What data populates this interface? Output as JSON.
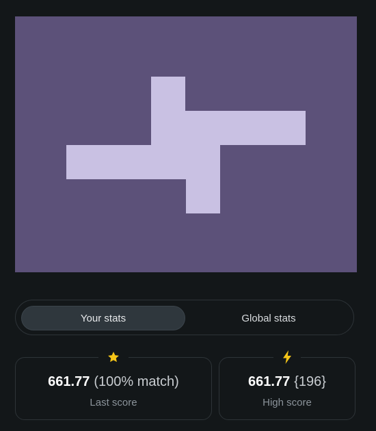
{
  "puzzle": {
    "background_color": "#5c5179",
    "piece_color": "#c9c1e3"
  },
  "tabs": {
    "your_stats": "Your stats",
    "global_stats": "Global stats",
    "active": "your_stats"
  },
  "last_score": {
    "icon": "star-icon",
    "icon_color": "#f5c518",
    "value": "661.77",
    "extra": "(100% match)",
    "label": "Last score"
  },
  "high_score": {
    "icon": "lightning-icon",
    "icon_color": "#f5c518",
    "value": "661.77",
    "extra": "{196}",
    "label": "High score"
  }
}
